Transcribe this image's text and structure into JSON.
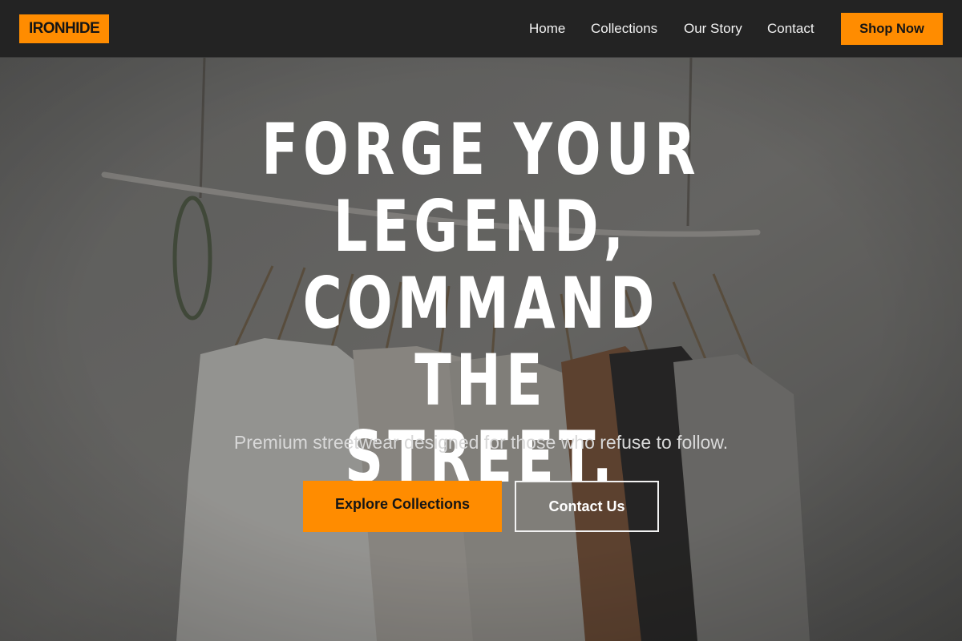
{
  "brand": {
    "name": "IRONHIDE",
    "accent_color": "#ff8c00",
    "nav_bg": "#232323"
  },
  "nav": {
    "links": [
      {
        "label": "Home"
      },
      {
        "label": "Collections"
      },
      {
        "label": "Our Story"
      },
      {
        "label": "Contact"
      }
    ],
    "cta_label": "Shop Now"
  },
  "hero": {
    "headline_lines": [
      "FORGE YOUR",
      "LEGEND,",
      "COMMAND THE",
      "STREET."
    ],
    "subtitle": "Premium streetwear designed for those who refuse to follow.",
    "primary_cta": "Explore Collections",
    "secondary_cta": "Contact Us",
    "background_image": "clothing-rack-photo"
  }
}
